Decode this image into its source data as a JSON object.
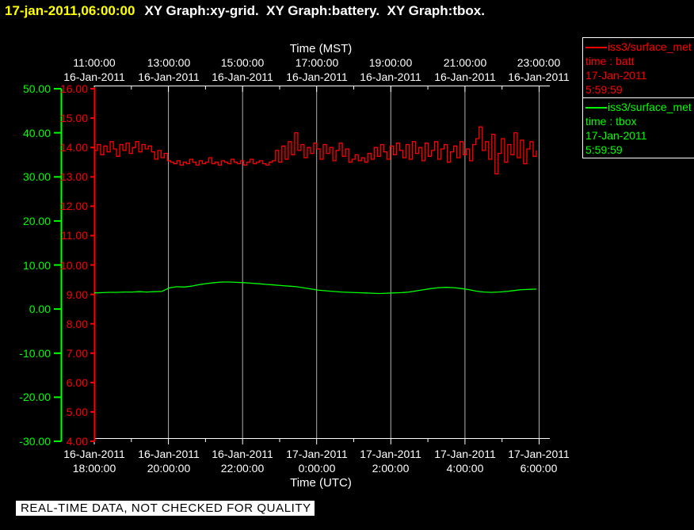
{
  "title_bar": {
    "datetime": "17-jan-2011,06:00:00",
    "graphs": "XY Graph:xy-grid.  XY Graph:battery.  XY Graph:tbox."
  },
  "colors": {
    "background": "#000000",
    "batt": "#ff0000",
    "tbox": "#00ff00",
    "axis_white": "#ffffff",
    "grid": "#b0b0b0",
    "title_time": "#ffff00"
  },
  "chart_data": {
    "type": "line",
    "top_axis": {
      "label": "Time (MST)",
      "times": [
        "11:00:00",
        "13:00:00",
        "15:00:00",
        "17:00:00",
        "19:00:00",
        "21:00:00",
        "23:00:00"
      ],
      "dates": [
        "16-Jan-2011",
        "16-Jan-2011",
        "16-Jan-2011",
        "16-Jan-2011",
        "16-Jan-2011",
        "16-Jan-2011",
        "16-Jan-2011"
      ]
    },
    "bottom_axis": {
      "label": "Time (UTC)",
      "dates": [
        "16-Jan-2011",
        "16-Jan-2011",
        "16-Jan-2011",
        "17-Jan-2011",
        "17-Jan-2011",
        "17-Jan-2011",
        "17-Jan-2011"
      ],
      "times": [
        "18:00:00",
        "20:00:00",
        "22:00:00",
        "0:00:00",
        "2:00:00",
        "4:00:00",
        "6:00:00"
      ]
    },
    "y_axis_green": {
      "color": "#00ff00",
      "ticks": [
        "50.00",
        "40.00",
        "30.00",
        "20.00",
        "10.00",
        "0.00",
        "-10.00",
        "-20.00",
        "-30.00"
      ],
      "range": [
        -30,
        50
      ]
    },
    "y_axis_red": {
      "color": "#ff0000",
      "ticks": [
        "16.00",
        "15.00",
        "14.00",
        "13.00",
        "12.00",
        "11.00",
        "10.00",
        "9.00",
        "8.00",
        "7.00",
        "6.00",
        "5.00",
        "4.00"
      ],
      "range": [
        4,
        16
      ]
    },
    "grid": true,
    "series": [
      {
        "name": "batt",
        "color": "#ff0000",
        "axis": "red",
        "style": "step",
        "values": [
          13.9,
          14.1,
          13.75,
          14.05,
          13.85,
          14.2,
          13.95,
          13.7,
          14.1,
          13.9,
          14.15,
          13.8,
          14.0,
          14.2,
          13.85,
          14.1,
          13.95,
          14.05,
          13.85,
          13.6,
          13.9,
          13.65,
          13.8,
          13.55,
          13.5,
          13.45,
          13.55,
          13.4,
          13.5,
          13.45,
          13.6,
          13.5,
          13.4,
          13.55,
          13.45,
          13.5,
          13.65,
          13.45,
          13.5,
          13.4,
          13.55,
          13.5,
          13.45,
          13.6,
          13.5,
          13.45,
          13.55,
          13.4,
          13.5,
          13.6,
          13.45,
          13.5,
          13.55,
          13.45,
          13.4,
          13.5,
          13.55,
          13.9,
          13.5,
          14.05,
          13.6,
          14.2,
          13.75,
          14.5,
          13.9,
          14.1,
          13.65,
          14.0,
          13.8,
          14.15,
          13.95,
          13.6,
          14.1,
          13.8,
          14.0,
          13.55,
          13.9,
          14.15,
          13.7,
          13.95,
          13.5,
          13.6,
          13.75,
          13.55,
          13.65,
          13.5,
          13.8,
          13.6,
          14.0,
          13.7,
          14.1,
          13.85,
          13.6,
          14.05,
          13.75,
          14.15,
          13.9,
          13.65,
          14.1,
          13.6,
          14.2,
          13.8,
          14.0,
          13.55,
          14.15,
          13.7,
          13.9,
          14.2,
          13.6,
          13.95,
          14.1,
          13.5,
          13.85,
          14.05,
          13.65,
          14.2,
          13.75,
          13.95,
          13.55,
          14.1,
          14.3,
          14.7,
          13.9,
          14.2,
          13.6,
          14.45,
          13.1,
          13.8,
          14.3,
          13.5,
          14.1,
          13.75,
          14.5,
          13.65,
          14.25,
          13.45,
          13.95,
          14.2,
          13.7,
          13.9
        ]
      },
      {
        "name": "tbox",
        "color": "#00ff00",
        "axis": "red",
        "style": "linear",
        "values": [
          9.05,
          9.06,
          9.07,
          9.07,
          9.08,
          9.08,
          9.09,
          9.08,
          9.09,
          9.1,
          9.22,
          9.26,
          9.25,
          9.28,
          9.33,
          9.37,
          9.4,
          9.42,
          9.42,
          9.41,
          9.4,
          9.38,
          9.36,
          9.34,
          9.32,
          9.3,
          9.28,
          9.26,
          9.22,
          9.18,
          9.14,
          9.12,
          9.1,
          9.08,
          9.07,
          9.06,
          9.05,
          9.04,
          9.03,
          9.04,
          9.05,
          9.06,
          9.08,
          9.12,
          9.16,
          9.2,
          9.23,
          9.24,
          9.23,
          9.2,
          9.16,
          9.11,
          9.08,
          9.07,
          9.08,
          9.1,
          9.13,
          9.16,
          9.17,
          9.18
        ]
      }
    ]
  },
  "legend": {
    "entries": [
      {
        "source": "iss3/surface_met",
        "field": "time : batt",
        "date": "17-Jan-2011",
        "time": "5:59:59",
        "color": "#ff0000"
      },
      {
        "source": "iss3/surface_met",
        "field": "time : tbox",
        "date": "17-Jan-2011",
        "time": "5:59:59",
        "color": "#00ff00"
      }
    ]
  },
  "status_bar": {
    "text": "REAL-TIME DATA, NOT CHECKED FOR QUALITY"
  }
}
